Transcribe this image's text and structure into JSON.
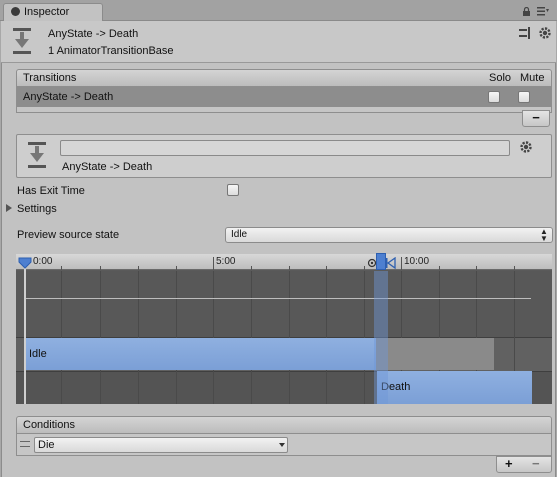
{
  "tab": {
    "title": "Inspector"
  },
  "header": {
    "title": "AnyState -> Death",
    "subtitle": "1 AnimatorTransitionBase"
  },
  "transitions": {
    "header_label": "Transitions",
    "solo_label": "Solo",
    "mute_label": "Mute",
    "items": [
      {
        "label": "AnyState -> Death",
        "solo": false,
        "mute": false
      }
    ],
    "remove_label": "−"
  },
  "transition_box": {
    "name_value": "",
    "label": "AnyState -> Death"
  },
  "has_exit_time": {
    "label": "Has Exit Time",
    "checked": false
  },
  "settings": {
    "label": "Settings",
    "expanded": false
  },
  "preview": {
    "label": "Preview source state",
    "selected": "Idle"
  },
  "timeline": {
    "ticks": [
      "0:00",
      "5:00",
      "10:00"
    ],
    "source_clip": "Idle",
    "destination_clip": "Death",
    "colors": {
      "clip": "#7b9fd6",
      "marker": "#4d7fd0"
    }
  },
  "conditions": {
    "header_label": "Conditions",
    "items": [
      {
        "parameter": "Die"
      }
    ],
    "add_label": "+",
    "remove_label": "−"
  }
}
